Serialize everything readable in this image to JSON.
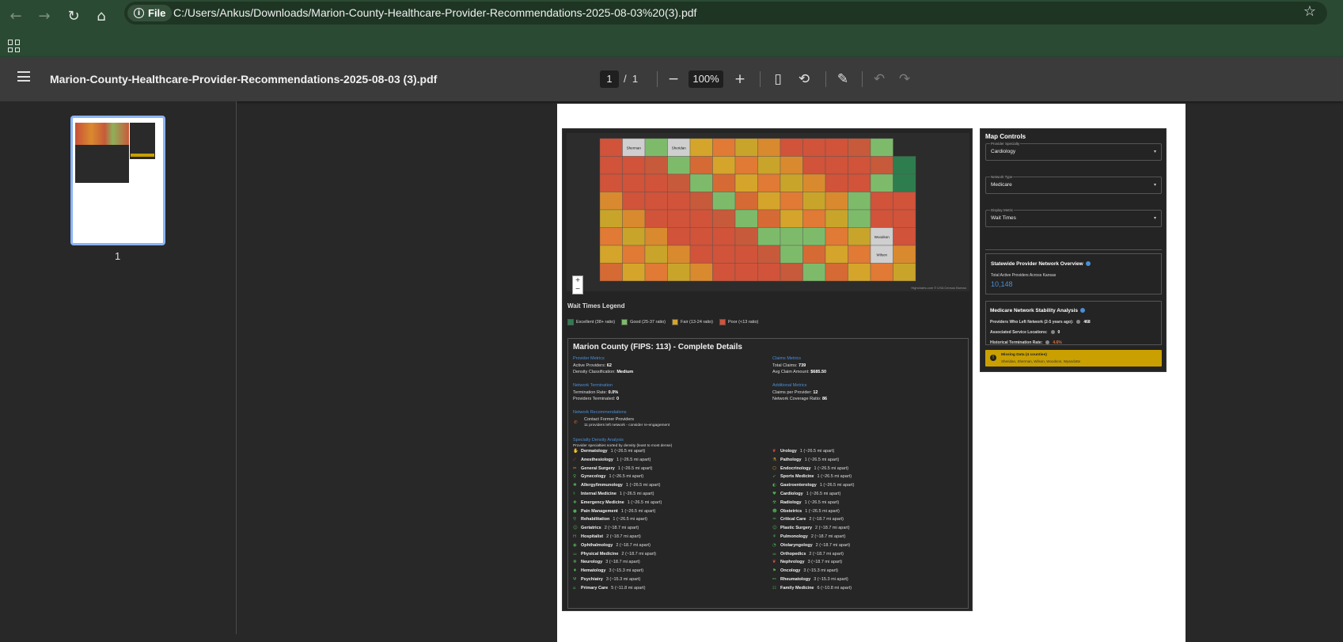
{
  "browser": {
    "protocol_label": "File",
    "url": "C:/Users/Ankus/Downloads/Marion-County-Healthcare-Provider-Recommendations-2025-08-03%20(3).pdf"
  },
  "pdf_toolbar": {
    "title": "Marion-County-Healthcare-Provider-Recommendations-2025-08-03 (3).pdf",
    "current_page": "1",
    "total_pages": "1",
    "page_separator": "/",
    "zoom": "100%"
  },
  "sidebar": {
    "thumbnail_label": "1"
  },
  "map": {
    "legend_title": "Wait Times Legend",
    "legend": [
      {
        "label": "Excellent (38+ ratio)",
        "color": "#2e7d4f"
      },
      {
        "label": "Good (25-37 ratio)",
        "color": "#7dbb6a"
      },
      {
        "label": "Fair (13-24 ratio)",
        "color": "#d4a52a"
      },
      {
        "label": "Poor (<13 ratio)",
        "color": "#d0533a"
      }
    ],
    "attribution": "Highcharts.com © USA Census Bureau",
    "gray_counties": [
      "Sherman",
      "Sheridan",
      "Wilson",
      "Woodson"
    ],
    "zoom_in": "+",
    "zoom_out": "−"
  },
  "details": {
    "title": "Marion County (FIPS: 113) - Complete Details",
    "provider_metrics": {
      "heading": "Provider Metrics",
      "active_label": "Active Providers:",
      "active_value": "62",
      "density_label": "Density Classification:",
      "density_value": "Medium"
    },
    "claims_metrics": {
      "heading": "Claims Metrics",
      "total_label": "Total Claims:",
      "total_value": "739",
      "avg_label": "Avg Claim Amount:",
      "avg_value": "$685.50"
    },
    "network_termination": {
      "heading": "Network Termination",
      "rate_label": "Termination Rate:",
      "rate_value": "0.0%",
      "terminated_label": "Providers Terminated:",
      "terminated_value": "0"
    },
    "additional_metrics": {
      "heading": "Additional Metrics",
      "cpp_label": "Claims per Provider:",
      "cpp_value": "12",
      "coverage_label": "Network Coverage Ratio:",
      "coverage_value": "86"
    },
    "recommendations": {
      "heading": "Network Recommendations",
      "item_title": "Contact Former Providers",
      "item_desc": "11 providers left network - consider re-engagement"
    },
    "specialty": {
      "heading": "Specialty Density Analysis",
      "subheading": "Provider specialties sorted by density (least to most dense)",
      "left": [
        {
          "name": "Dermatology",
          "detail": "1 (~26.5 mi apart)",
          "icon": "hand-icon"
        },
        {
          "name": "Anesthesiology",
          "detail": "1 (~26.5 mi apart)",
          "icon": "syringe-icon"
        },
        {
          "name": "General Surgery",
          "detail": "1 (~26.5 mi apart)",
          "icon": "scalpel-icon"
        },
        {
          "name": "Gynecology",
          "detail": "1 (~26.5 mi apart)",
          "icon": "female-icon"
        },
        {
          "name": "Allergy/Immunology",
          "detail": "1 (~26.5 mi apart)",
          "icon": "allergy-icon"
        },
        {
          "name": "Internal Medicine",
          "detail": "1 (~26.5 mi apart)",
          "icon": "stethoscope-icon"
        },
        {
          "name": "Emergency Medicine",
          "detail": "1 (~26.5 mi apart)",
          "icon": "ambulance-icon"
        },
        {
          "name": "Pain Management",
          "detail": "1 (~26.5 mi apart)",
          "icon": "pill-icon"
        },
        {
          "name": "Rehabilitation",
          "detail": "1 (~26.5 mi apart)",
          "icon": "walking-icon"
        },
        {
          "name": "Geriatrics",
          "detail": "2 (~18.7 mi apart)",
          "icon": "elderly-icon"
        },
        {
          "name": "Hospitalist",
          "detail": "2 (~18.7 mi apart)",
          "icon": "hospital-icon"
        },
        {
          "name": "Ophthalmology",
          "detail": "2 (~18.7 mi apart)",
          "icon": "eye-icon"
        },
        {
          "name": "Physical Medicine",
          "detail": "2 (~18.7 mi apart)",
          "icon": "dumbbell-icon"
        },
        {
          "name": "Neurology",
          "detail": "3 (~18.7 mi apart)",
          "icon": "brain-icon"
        },
        {
          "name": "Hematology",
          "detail": "3 (~15.3 mi apart)",
          "icon": "blood-drop-icon"
        },
        {
          "name": "Psychiatry",
          "detail": "3 (~15.3 mi apart)",
          "icon": "psychology-icon"
        },
        {
          "name": "Primary Care",
          "detail": "5 (~11.8 mi apart)",
          "icon": "clinic-icon"
        }
      ],
      "right": [
        {
          "name": "Urology",
          "detail": "1 (~26.5 mi apart)",
          "icon": "kidney-icon"
        },
        {
          "name": "Pathology",
          "detail": "1 (~26.5 mi apart)",
          "icon": "microscope-icon"
        },
        {
          "name": "Endocrinology",
          "detail": "1 (~26.5 mi apart)",
          "icon": "hormone-icon"
        },
        {
          "name": "Sports Medicine",
          "detail": "1 (~26.5 mi apart)",
          "icon": "running-icon"
        },
        {
          "name": "Gastroenterology",
          "detail": "1 (~26.5 mi apart)",
          "icon": "stomach-icon"
        },
        {
          "name": "Cardiology",
          "detail": "1 (~26.5 mi apart)",
          "icon": "heart-icon"
        },
        {
          "name": "Radiology",
          "detail": "1 (~26.5 mi apart)",
          "icon": "radiation-icon"
        },
        {
          "name": "Obstetrics",
          "detail": "1 (~26.5 mi apart)",
          "icon": "baby-icon"
        },
        {
          "name": "Critical Care",
          "detail": "2 (~18.7 mi apart)",
          "icon": "monitor-icon"
        },
        {
          "name": "Plastic Surgery",
          "detail": "2 (~18.7 mi apart)",
          "icon": "face-icon"
        },
        {
          "name": "Pulmonology",
          "detail": "2 (~18.7 mi apart)",
          "icon": "lungs-icon"
        },
        {
          "name": "Otolaryngology",
          "detail": "2 (~18.7 mi apart)",
          "icon": "ear-icon"
        },
        {
          "name": "Orthopedics",
          "detail": "2 (~18.7 mi apart)",
          "icon": "bone-icon"
        },
        {
          "name": "Nephrology",
          "detail": "3 (~18.7 mi apart)",
          "icon": "kidney-icon"
        },
        {
          "name": "Oncology",
          "detail": "3 (~15.3 mi apart)",
          "icon": "ribbon-icon"
        },
        {
          "name": "Rheumatology",
          "detail": "3 (~15.3 mi apart)",
          "icon": "joint-icon"
        },
        {
          "name": "Family Medicine",
          "detail": "6 (~10.8 mi apart)",
          "icon": "family-icon"
        }
      ]
    }
  },
  "controls": {
    "title": "Map Controls",
    "specialty_label": "Provider Specialty",
    "specialty_value": "Cardiology",
    "network_label": "Network Type",
    "network_value": "Medicare",
    "metric_label": "Display Metric",
    "metric_value": "Wait Times",
    "overview": {
      "title": "Statewide Provider Network Overview",
      "label": "Total Active Providers Across Kansas",
      "value": "10,148"
    },
    "stability": {
      "title": "Medicare Network Stability Analysis",
      "left_label": "Providers Who Left Network (2-5 years ago):",
      "left_value": "468",
      "locations_label": "Associated Service Locations:",
      "locations_value": "0",
      "rate_label": "Historical Termination Rate:",
      "rate_value": "4.6%"
    },
    "missing": {
      "title": "Missing Data (4 counties)",
      "list": "Sheridan, Sherman, Wilson, Woodson, Wyandotte"
    }
  },
  "colors": {
    "accent": "#4a8fd8",
    "warning": "#c9a000",
    "rate_orange": "#e0733a"
  }
}
